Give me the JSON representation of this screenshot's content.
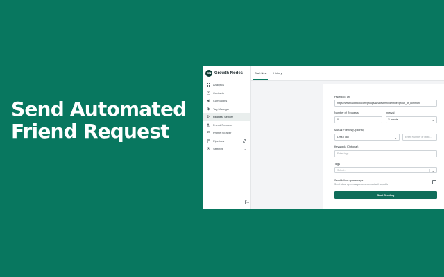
{
  "headline": {
    "line1": "Send Automated",
    "line2": "Friend Request"
  },
  "app": {
    "brand": {
      "logo_text": "GN",
      "name": "Growth Nodes"
    },
    "sidebar": {
      "items": [
        {
          "label": "Analytics",
          "icon": "analytics-icon"
        },
        {
          "label": "Contacts",
          "icon": "contacts-icon"
        },
        {
          "label": "Campaigns",
          "icon": "campaigns-icon"
        },
        {
          "label": "Tag Manager",
          "icon": "tag-icon"
        },
        {
          "label": "Request Sender",
          "icon": "request-sender-icon",
          "active": true
        },
        {
          "label": "Friend Remover",
          "icon": "friend-remover-icon"
        },
        {
          "label": "Profile Scraper",
          "icon": "profile-scraper-icon"
        },
        {
          "label": "Pipelines",
          "icon": "pipelines-icon"
        },
        {
          "label": "Settings",
          "icon": "settings-icon"
        }
      ],
      "logout_icon": "logout-icon"
    },
    "tabs": [
      {
        "label": "Start New",
        "active": true
      },
      {
        "label": "History"
      }
    ],
    "form": {
      "facebook_url": {
        "label": "Facebook url",
        "value": "https://www.facebook.com/groups/whatevertheidentifier/group_of_common"
      },
      "num_requests": {
        "label": "Number of Requests",
        "value": "0"
      },
      "interval": {
        "label": "Interval",
        "value": "1 minute"
      },
      "mutual_friends": {
        "label": "Mutual Friends (Optional)",
        "value": "Less Than",
        "number_placeholder": "Enter Number of Mutu..."
      },
      "keywords": {
        "label": "Keywords (Optional)",
        "placeholder": "Enter tags"
      },
      "tags": {
        "label": "Tags",
        "placeholder": "Select..."
      },
      "follow_up": {
        "label": "Send follow up message",
        "sub": "Send follow up messages once connect with a profile"
      },
      "submit_label": "Start Sending"
    },
    "colors": {
      "background": "#08775f",
      "accent": "#0f6d5a",
      "brand_dark": "#0d3b33"
    }
  }
}
